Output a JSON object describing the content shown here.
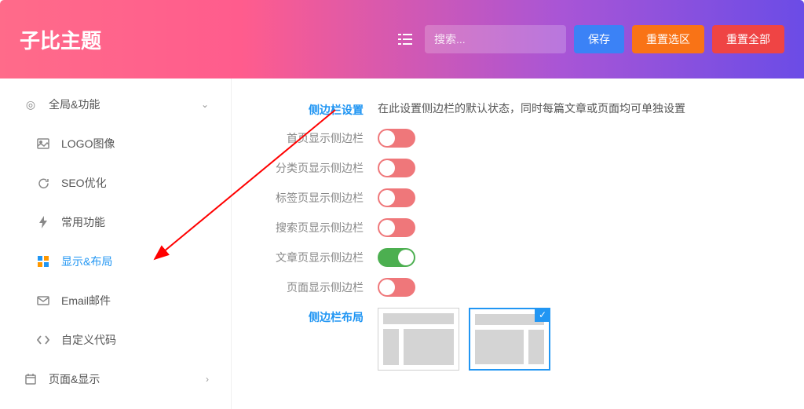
{
  "header": {
    "title": "子比主题",
    "search_placeholder": "搜索...",
    "save_label": "保存",
    "reset_area_label": "重置选区",
    "reset_all_label": "重置全部"
  },
  "sidebar": {
    "items": [
      {
        "label": "全局&功能",
        "icon": "target-icon",
        "type": "parent",
        "has_chevron": true
      },
      {
        "label": "LOGO图像",
        "icon": "image-icon",
        "type": "sub"
      },
      {
        "label": "SEO优化",
        "icon": "refresh-icon",
        "type": "sub"
      },
      {
        "label": "常用功能",
        "icon": "bolt-icon",
        "type": "sub"
      },
      {
        "label": "显示&布局",
        "icon": "layout-icon",
        "type": "sub",
        "active": true
      },
      {
        "label": "Email邮件",
        "icon": "mail-icon",
        "type": "sub"
      },
      {
        "label": "自定义代码",
        "icon": "code-icon",
        "type": "sub"
      },
      {
        "label": "页面&显示",
        "icon": "calendar-icon",
        "type": "parent",
        "has_chevron_right": true
      }
    ]
  },
  "content": {
    "section_title": "侧边栏设置",
    "section_desc": "在此设置侧边栏的默认状态，同时每篇文章或页面均可单独设置",
    "toggles": [
      {
        "label": "首页显示侧边栏",
        "state": "off-red"
      },
      {
        "label": "分类页显示侧边栏",
        "state": "off-red"
      },
      {
        "label": "标签页显示侧边栏",
        "state": "off-red"
      },
      {
        "label": "搜索页显示侧边栏",
        "state": "off-red"
      },
      {
        "label": "文章页显示侧边栏",
        "state": "on-green"
      },
      {
        "label": "页面显示侧边栏",
        "state": "off-red"
      }
    ],
    "layout_title": "侧边栏布局",
    "layout_options": [
      {
        "type": "sidebar-left",
        "selected": false
      },
      {
        "type": "sidebar-right",
        "selected": true
      }
    ]
  }
}
